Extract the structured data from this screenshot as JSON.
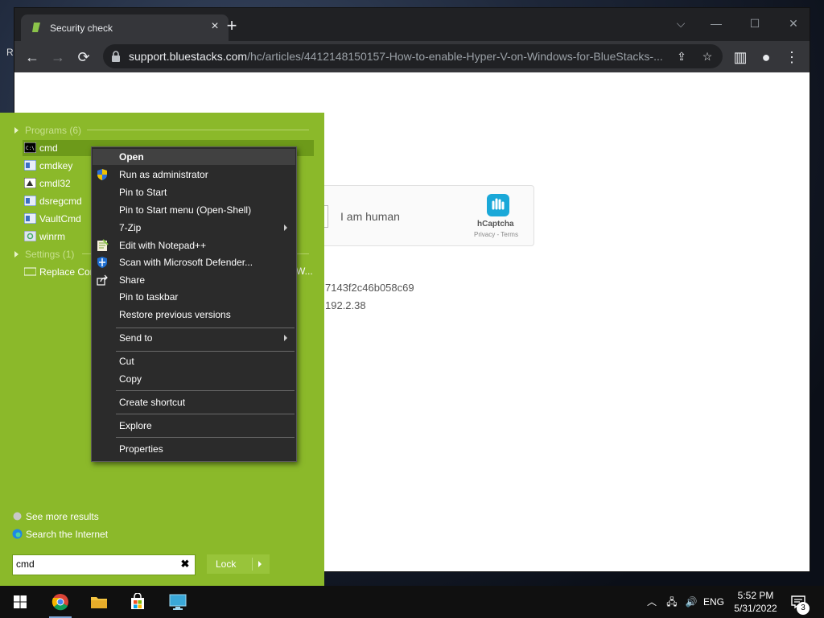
{
  "desktop": {
    "partial_label": "R"
  },
  "browser": {
    "tab_title": "Security check",
    "url_host": "support.bluestacks.com",
    "url_path": "/hc/articles/4412148150157-How-to-enable-Hyper-V-on-Windows-for-BlueStacks-..."
  },
  "page": {
    "captcha_label": "I am human",
    "captcha_brand": "hCaptcha",
    "captcha_links": "Privacy - Terms",
    "ray_id_fragment": "7143f2c46b058c69",
    "ip_fragment": "192.2.38"
  },
  "startmenu": {
    "programs_header": "Programs (6)",
    "programs": [
      {
        "label": "cmd"
      },
      {
        "label": "cmdkey"
      },
      {
        "label": "cmdl32"
      },
      {
        "label": "dsregcmd"
      },
      {
        "label": "VaultCmd"
      },
      {
        "label": "winrm"
      }
    ],
    "settings_header": "Settings (1)",
    "settings_item": "Replace Cor",
    "settings_item_overflow": "W...",
    "see_more": "See more results",
    "search_internet": "Search the Internet",
    "search_value": "cmd",
    "lock_label": "Lock"
  },
  "context_menu": {
    "items": [
      {
        "label": "Open"
      },
      {
        "label": "Run as administrator"
      },
      {
        "label": "Pin to Start"
      },
      {
        "label": "Pin to Start menu (Open-Shell)"
      },
      {
        "label": "7-Zip"
      },
      {
        "label": "Edit with Notepad++"
      },
      {
        "label": "Scan with Microsoft Defender..."
      },
      {
        "label": "Share"
      },
      {
        "label": "Pin to taskbar"
      },
      {
        "label": "Restore previous versions"
      },
      {
        "label": "Send to"
      },
      {
        "label": "Cut"
      },
      {
        "label": "Copy"
      },
      {
        "label": "Create shortcut"
      },
      {
        "label": "Explore"
      },
      {
        "label": "Properties"
      }
    ]
  },
  "taskbar": {
    "language": "ENG",
    "time": "5:52 PM",
    "date": "5/31/2022",
    "notification_count": "3"
  },
  "colors": {
    "startmenu_bg": "#8bb92a",
    "startmenu_selected": "#6d9a1a",
    "context_bg": "#2b2b2b",
    "browser_chrome": "#35363a"
  }
}
